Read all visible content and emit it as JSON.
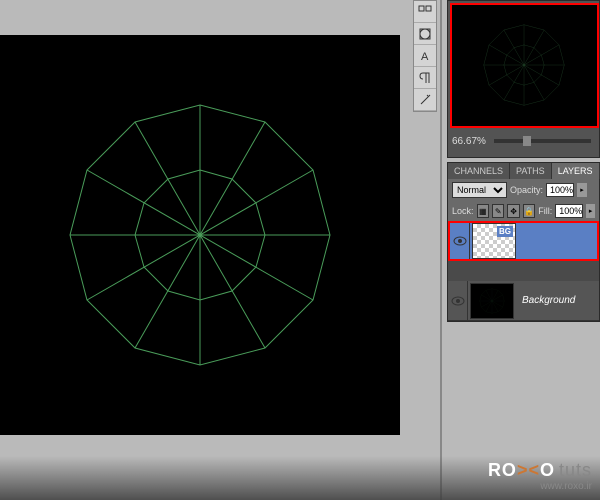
{
  "navigator": {
    "zoom": "66.67%"
  },
  "tabs": {
    "channels": "CHANNELS",
    "paths": "PATHS",
    "layers": "LAYERS"
  },
  "layer_controls": {
    "blend_mode": "Normal",
    "opacity_label": "Opacity:",
    "opacity_value": "100%",
    "lock_label": "Lock:",
    "fill_label": "Fill:",
    "fill_value": "100%"
  },
  "layers": [
    {
      "name": "BG",
      "thumb_label": "BG",
      "selected": true,
      "highlighted": true,
      "transparent": true,
      "italic": false
    },
    {
      "name": "Background",
      "thumb_label": "",
      "selected": false,
      "highlighted": false,
      "transparent": false,
      "italic": true
    }
  ],
  "watermark": {
    "brand_left": "RO",
    "brand_mid": "><",
    "brand_right": "O",
    "tuts": "tuts",
    "url": "www.roxo.ir"
  },
  "colors": {
    "wireframe": "#4a9d5a",
    "highlight": "#ff0000",
    "selection": "#5a7fc4"
  }
}
